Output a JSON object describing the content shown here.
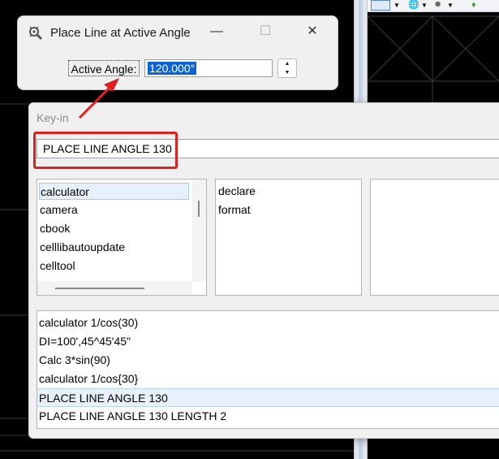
{
  "colors": {
    "accent_red": "#e0201c",
    "selection_blue": "#0a64d8",
    "canvas_bg": "#000000",
    "grid_line": "#3a3a3a"
  },
  "toolbar": {
    "icons": [
      "info-card-icon",
      "globe-icon",
      "sun-icon",
      "map-pin-icon"
    ]
  },
  "place_line_dialog": {
    "title": "Place Line at Active Angle",
    "angle_label": "Active Angle:",
    "angle_value": "120.000°",
    "minimize": "—",
    "maximize": "☐",
    "close": "✕",
    "spin_up": "▲",
    "spin_down": "▼"
  },
  "keyin_dialog": {
    "title": "Key-in",
    "input_value": "PLACE LINE ANGLE 130",
    "list1": [
      "calculator",
      "camera",
      "cbook",
      "celllibautoupdate",
      "celltool"
    ],
    "list2": [
      "declare",
      "format"
    ],
    "history": [
      "calculator 1/cos(30)",
      "DI=100',45^45'45\"",
      "Calc 3*sin(90)",
      "calculator 1/cos{30}",
      "PLACE LINE ANGLE 130",
      "PLACE LINE ANGLE 130 LENGTH 2"
    ]
  }
}
